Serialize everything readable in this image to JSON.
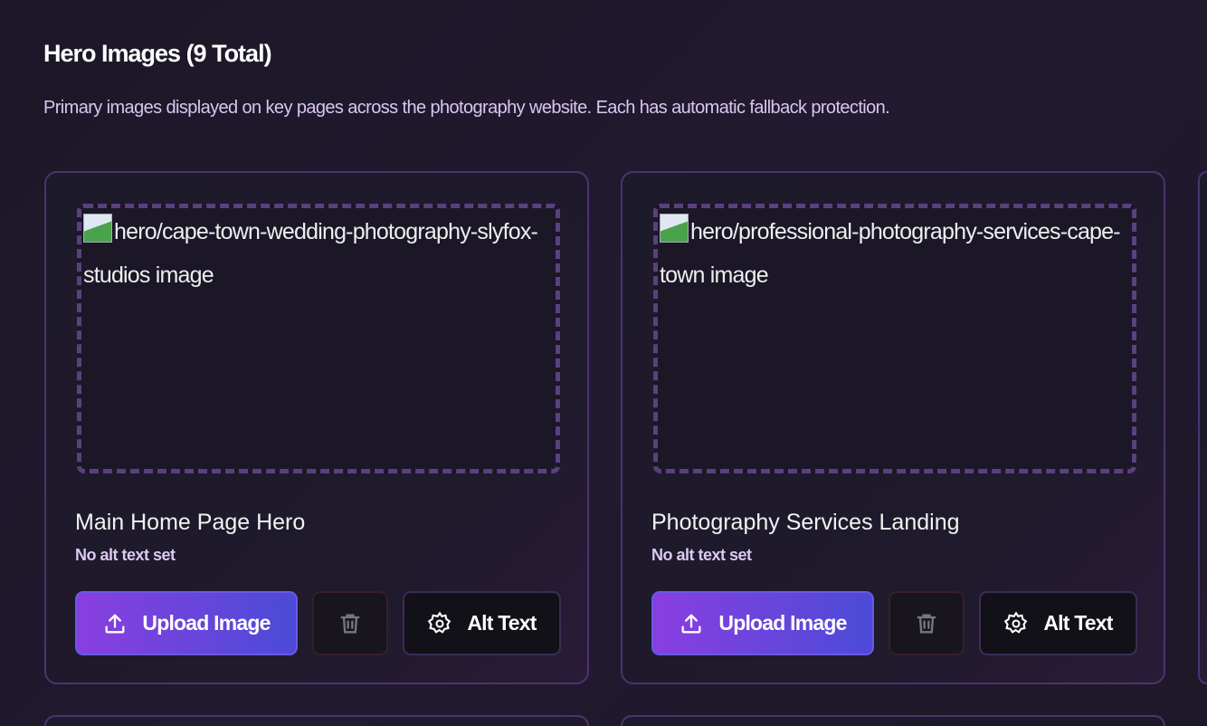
{
  "section": {
    "title": "Hero Images (9 Total)",
    "description": "Primary images displayed on key pages across the photography website. Each has automatic fallback protection."
  },
  "cards": [
    {
      "image_alt": "hero/cape-town-wedding-photography-slyfox-studios image",
      "title": "Main Home Page Hero",
      "alt_status": "No alt text set",
      "upload_label": "Upload Image",
      "alt_label": "Alt Text"
    },
    {
      "image_alt": "hero/professional-photography-services-cape-town image",
      "title": "Photography Services Landing",
      "alt_status": "No alt text set",
      "upload_label": "Upload Image",
      "alt_label": "Alt Text"
    }
  ]
}
